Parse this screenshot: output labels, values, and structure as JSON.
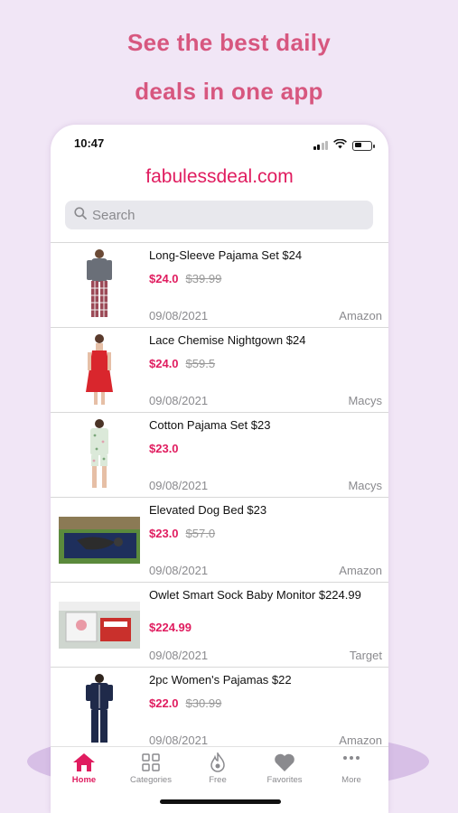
{
  "promo": {
    "line1": "See the best daily",
    "line2": "deals in one app"
  },
  "status_bar": {
    "time": "10:47",
    "icons": [
      "signal-icon",
      "wifi-icon",
      "battery-icon"
    ]
  },
  "app": {
    "brand": "fabulessdeal.com",
    "accent_color": "#e01c5f",
    "search": {
      "placeholder": "Search",
      "icon": "search-icon"
    }
  },
  "deals": [
    {
      "title": "Long-Sleeve Pajama Set $24",
      "price": "$24.0",
      "old_price": "$39.99",
      "date": "09/08/2021",
      "store": "Amazon",
      "image": "pajama-set-image"
    },
    {
      "title": "Lace Chemise Nightgown $24",
      "price": "$24.0",
      "old_price": "$59.5",
      "date": "09/08/2021",
      "store": "Macys",
      "image": "nightgown-image"
    },
    {
      "title": "Cotton Pajama Set $23",
      "price": "$23.0",
      "old_price": "",
      "date": "09/08/2021",
      "store": "Macys",
      "image": "cotton-pajama-image"
    },
    {
      "title": "Elevated Dog Bed $23",
      "price": "$23.0",
      "old_price": "$57.0",
      "date": "09/08/2021",
      "store": "Amazon",
      "image": "dog-bed-image"
    },
    {
      "title": "Owlet Smart Sock Baby Monitor $224.99",
      "price": "$224.99",
      "old_price": "",
      "date": "09/08/2021",
      "store": "Target",
      "image": "baby-monitor-image"
    },
    {
      "title": "2pc Women's Pajamas $22",
      "price": "$22.0",
      "old_price": "$30.99",
      "date": "09/08/2021",
      "store": "Amazon",
      "image": "womens-pajamas-image"
    }
  ],
  "tabs": [
    {
      "label": "Home",
      "icon": "home-icon",
      "active": true
    },
    {
      "label": "Categories",
      "icon": "grid-icon",
      "active": false
    },
    {
      "label": "Free",
      "icon": "flame-icon",
      "active": false
    },
    {
      "label": "Favorites",
      "icon": "heart-icon",
      "active": false
    },
    {
      "label": "More",
      "icon": "more-icon",
      "active": false
    }
  ]
}
